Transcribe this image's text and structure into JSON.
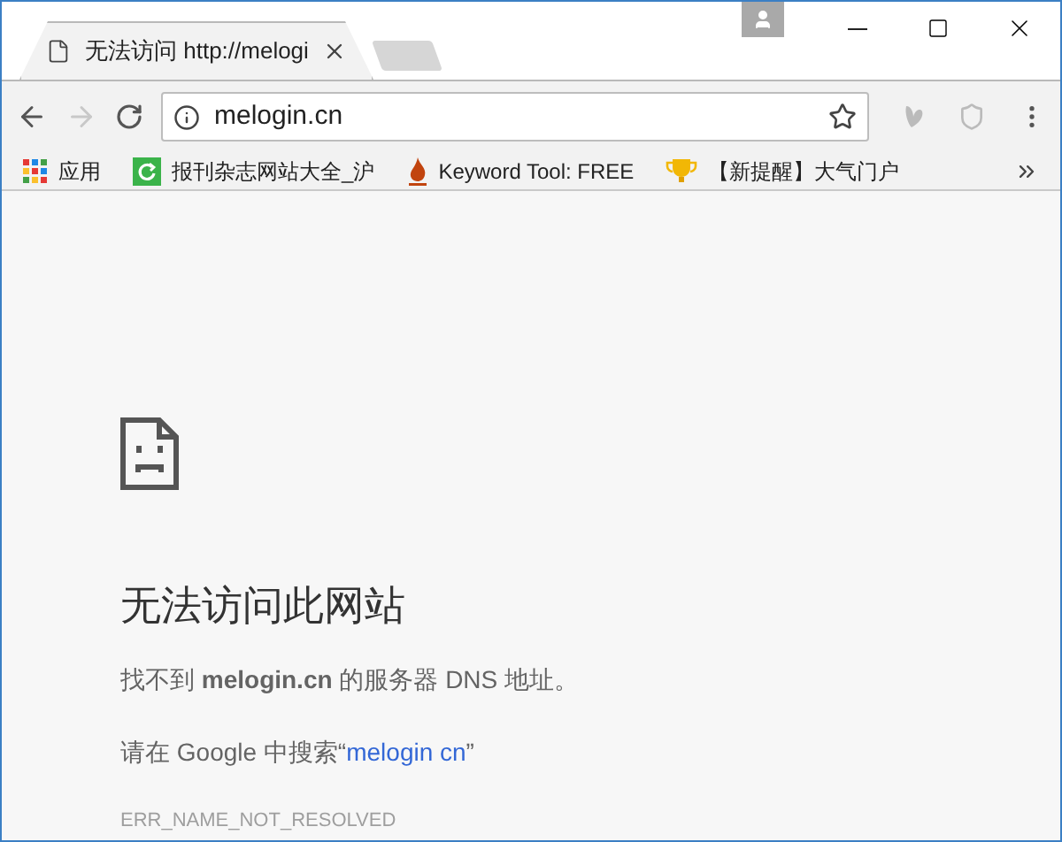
{
  "tab": {
    "title": "无法访问 http://melogi"
  },
  "toolbar": {
    "url": "melogin.cn",
    "forward_disabled": true
  },
  "bookmarks": [
    {
      "kind": "apps",
      "label": "应用"
    },
    {
      "kind": "refresh",
      "label": "报刊杂志网站大全_沪"
    },
    {
      "kind": "flame",
      "label": "Keyword Tool: FREE"
    },
    {
      "kind": "trophy",
      "label": "【新提醒】大气门户"
    }
  ],
  "error": {
    "heading": "无法访问此网站",
    "message": "找不到 **melogin.cn** 的服务器 DNS 地址。",
    "search_prefix": "请在 Google 中搜索“",
    "search_link": "melogin cn",
    "search_suffix": "”",
    "code": "ERR_NAME_NOT_RESOLVED"
  }
}
